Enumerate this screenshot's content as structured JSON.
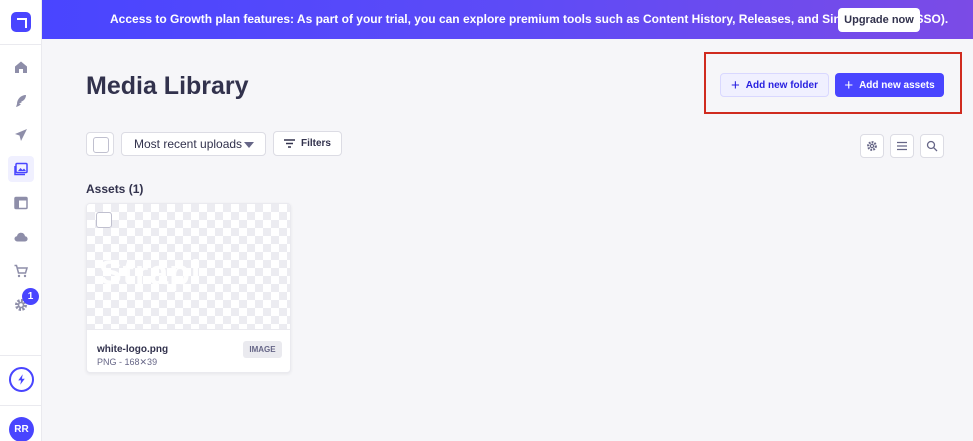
{
  "banner": {
    "text": "Access to Growth plan features: As part of your trial, you can explore premium tools such as Content History, Releases, and Single Sign-On (SSO).",
    "upgrade_label": "Upgrade now"
  },
  "nav": {
    "items": [
      {
        "icon": "home-icon"
      },
      {
        "icon": "feather-icon"
      },
      {
        "icon": "paper-plane-icon"
      },
      {
        "icon": "media-library-icon",
        "active": true
      },
      {
        "icon": "layout-icon"
      },
      {
        "icon": "cloud-icon"
      },
      {
        "icon": "cart-icon"
      },
      {
        "icon": "settings-icon"
      }
    ],
    "settings_badge": "1",
    "avatar_initials": "RR"
  },
  "header": {
    "title": "Media Library",
    "add_folder_label": "Add new folder",
    "add_assets_label": "Add new assets"
  },
  "toolbar": {
    "sort_value": "Most recent uploads",
    "filters_label": "Filters"
  },
  "assets": {
    "heading": "Assets (1)",
    "items": [
      {
        "name": "white-logo.png",
        "meta": "PNG - 168✕39",
        "type": "IMAGE"
      }
    ]
  },
  "colors": {
    "primary": "#4945ff",
    "highlight": "#d02b20",
    "background": "#f6f6f9"
  }
}
